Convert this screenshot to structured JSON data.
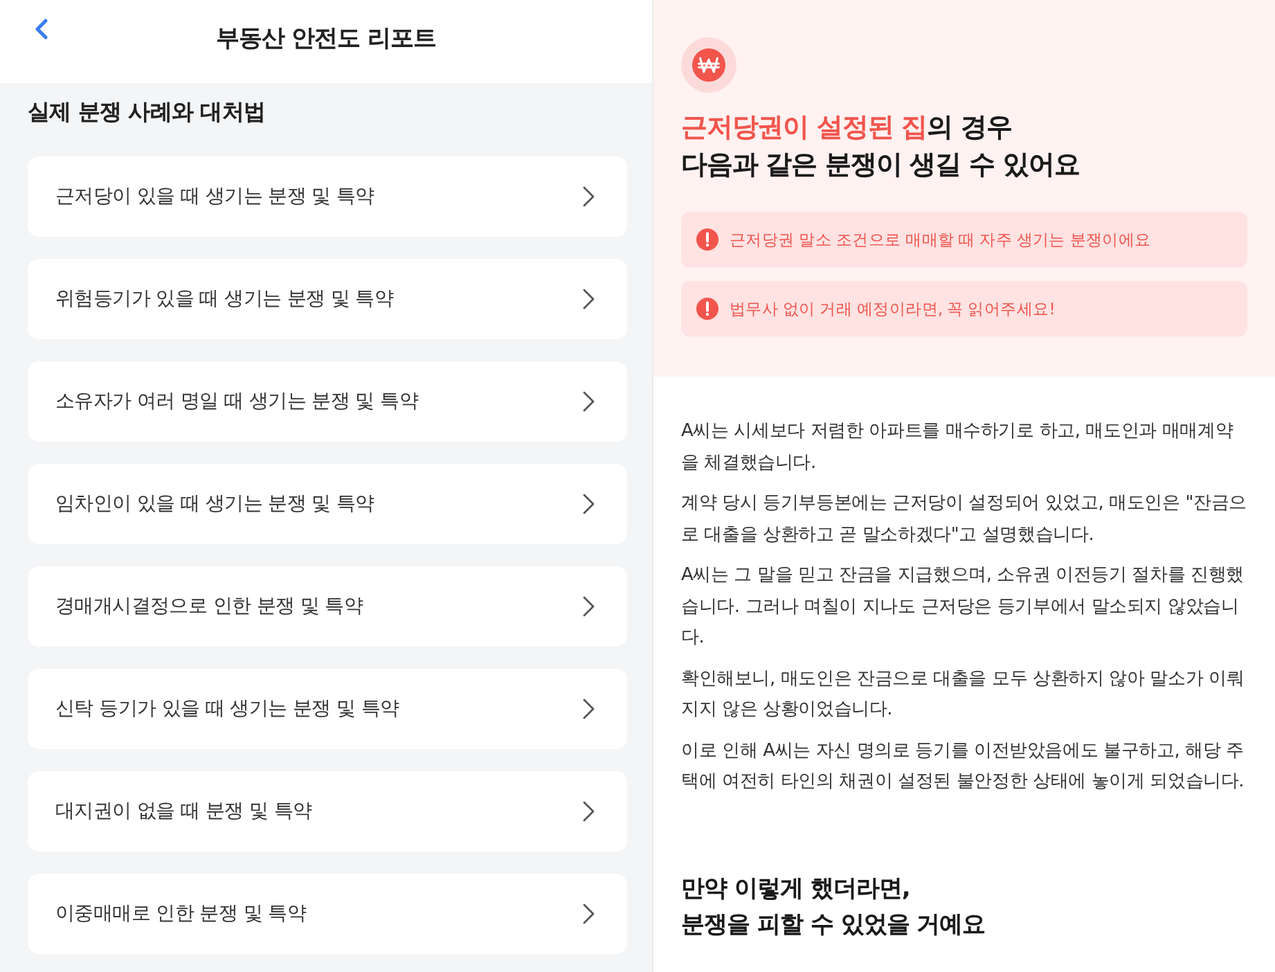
{
  "header": {
    "title": "부동산 안전도 리포트"
  },
  "section": {
    "title": "실제 분쟁 사례와 대처법",
    "items": [
      {
        "label": "근저당이 있을 때 생기는 분쟁 및 특약"
      },
      {
        "label": "위험등기가 있을 때 생기는 분쟁 및 특약"
      },
      {
        "label": "소유자가 여러 명일 때 생기는 분쟁 및 특약"
      },
      {
        "label": "임차인이 있을 때 생기는 분쟁 및 특약"
      },
      {
        "label": "경매개시결정으로 인한 분쟁 및 특약"
      },
      {
        "label": "신탁 등기가 있을 때 생기는 분쟁 및 특약"
      },
      {
        "label": "대지권이 없을 때 분쟁 및 특약"
      },
      {
        "label": "이중매매로 인한 분쟁 및 특약"
      }
    ]
  },
  "detail": {
    "heading": [
      [
        {
          "text": "근저당권이 설정된 집",
          "highlight": true
        },
        {
          "text": "의 경우",
          "highlight": false
        }
      ],
      [
        {
          "text": "다음과 같은 분쟁이 생길 수 있어요",
          "highlight": false
        }
      ]
    ],
    "alerts": [
      "근저당권 말소 조건으로 매매할 때 자주 생기는 분쟁이에요",
      "법무사 없이 거래 예정이라면, 꼭 읽어주세요!"
    ],
    "paragraphs": [
      "A씨는 시세보다 저렴한 아파트를 매수하기로 하고, 매도인과 매매계약을 체결했습니다.",
      "계약 당시 등기부등본에는 근저당이 설정되어 있었고, 매도인은 \"잔금으로 대출을 상환하고 곧 말소하겠다\"고 설명했습니다.",
      "A씨는 그 말을 믿고 잔금을 지급했으며, 소유권 이전등기 절차를 진행했습니다. 그러나 며칠이 지나도 근저당은 등기부에서 말소되지 않았습니다.",
      "확인해보니, 매도인은 잔금으로 대출을 모두 상환하지 않아 말소가 이뤄지지 않은 상황이었습니다.",
      "이로 인해 A씨는 자신 명의로 등기를 이전받았음에도 불구하고, 해당 주택에 여전히 타인의 채권이 설정된 불안정한 상태에 놓이게 되었습니다."
    ],
    "subheading": [
      "만약 이렇게 했더라면,",
      "분쟁을 피할 수 있었을 거예요"
    ]
  }
}
